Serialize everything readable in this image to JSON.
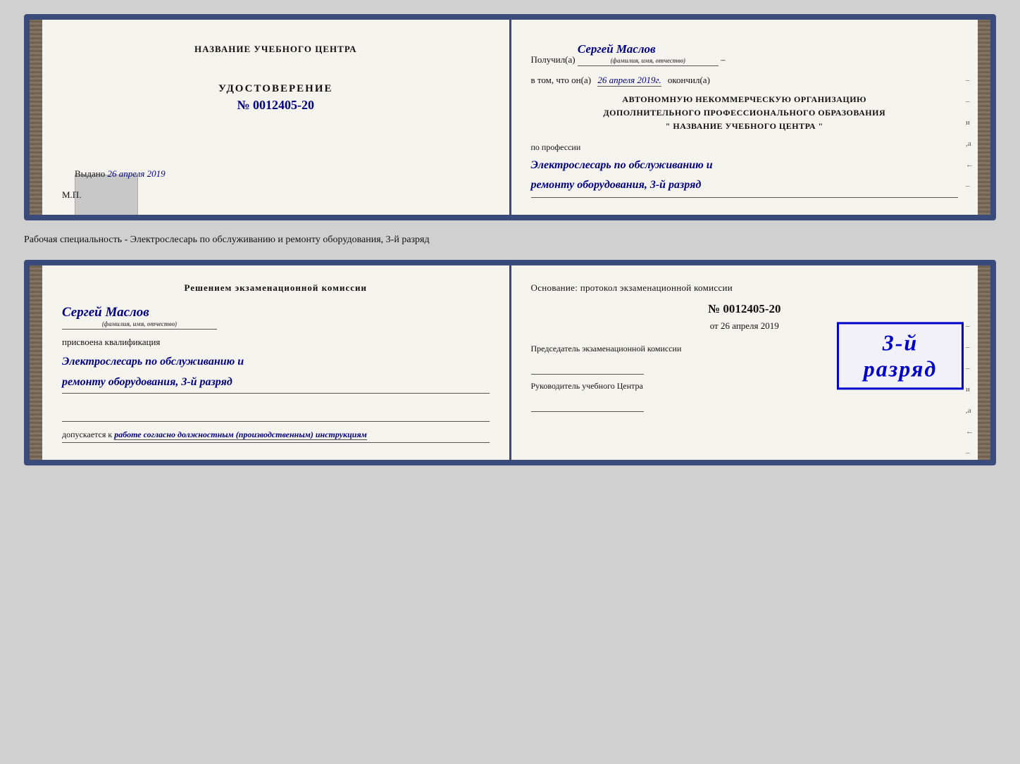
{
  "cert1": {
    "left": {
      "title": "НАЗВАНИЕ УЧЕБНОГО ЦЕНТРА",
      "udost_label": "УДОСТОВЕРЕНИЕ",
      "udost_number": "№ 0012405-20",
      "issued_label": "Выдано",
      "issued_date": "26 апреля 2019",
      "mp_label": "М.П."
    },
    "right": {
      "recipient_prefix": "Получил(а)",
      "recipient_name": "Сергей Маслов",
      "name_subtitle": "(фамилия, имя, отчество)",
      "dash": "–",
      "date_prefix": "в том, что он(а)",
      "date_value": "26 апреля 2019г.",
      "date_suffix": "окончил(а)",
      "org_line1": "АВТОНОМНУЮ НЕКОММЕРЧЕСКУЮ ОРГАНИЗАЦИЮ",
      "org_line2": "ДОПОЛНИТЕЛЬНОГО ПРОФЕССИОНАЛЬНОГО ОБРАЗОВАНИЯ",
      "org_line3": "\"    НАЗВАНИЕ УЧЕБНОГО ЦЕНТРА    \"",
      "profession_label": "по профессии",
      "profession_value": "Электрослесарь по обслуживанию и",
      "profession_value2": "ремонту оборудования, 3-й разряд"
    }
  },
  "description": "Рабочая специальность - Электрослесарь по обслуживанию и ремонту оборудования, 3-й разряд",
  "cert2": {
    "left": {
      "decision_title": "Решением экзаменационной комиссии",
      "person_name": "Сергей Маслов",
      "name_subtitle": "(фамилия, имя, отчество)",
      "qualification_label": "присвоена квалификация",
      "qualification_line1": "Электрослесарь по обслуживанию и",
      "qualification_line2": "ремонту оборудования, 3-й разряд",
      "allowed_prefix": "допускается к",
      "allowed_value": "работе согласно должностным (производственным) инструкциям"
    },
    "right": {
      "basis_label": "Основание: протокол экзаменационной комиссии",
      "protocol_number": "№  0012405-20",
      "protocol_date_prefix": "от",
      "protocol_date": "26 апреля 2019",
      "chairman_title": "Председатель экзаменационной комиссии",
      "head_title": "Руководитель учебного Центра"
    },
    "stamp": {
      "text": "3-й разряд"
    }
  }
}
